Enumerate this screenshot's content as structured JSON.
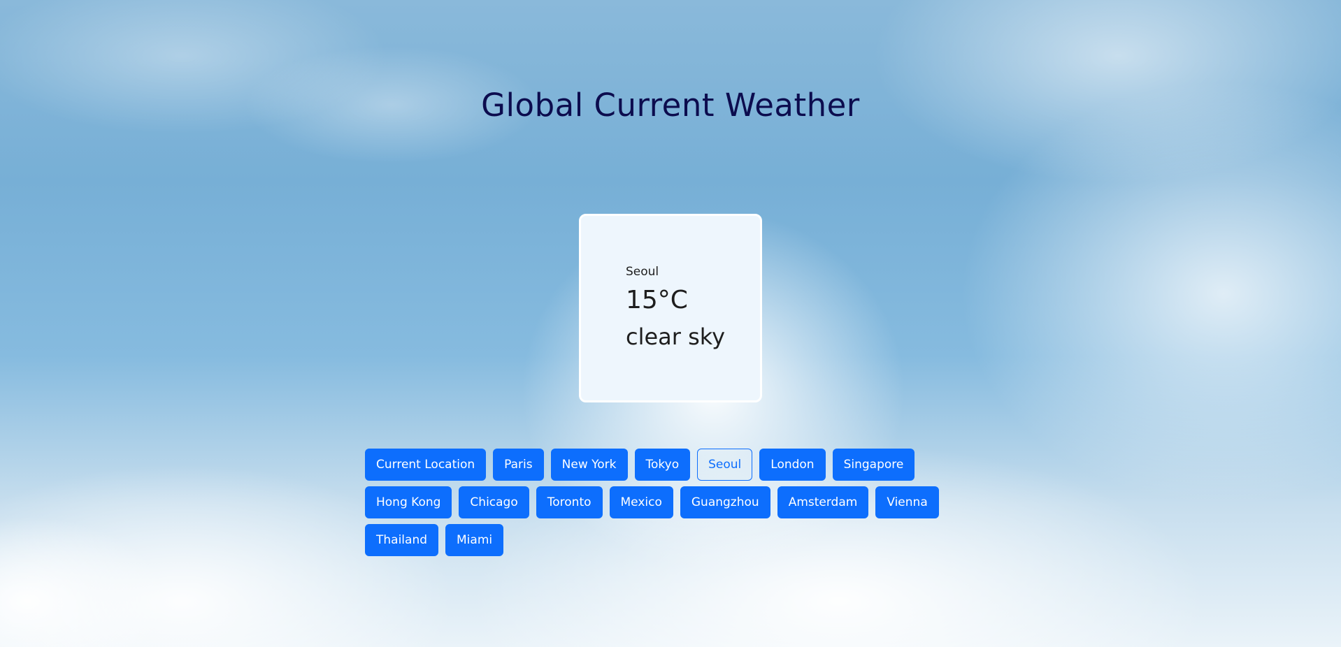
{
  "page": {
    "title": "Global Current Weather"
  },
  "weather": {
    "city": "Seoul",
    "temperature": "15°C",
    "description": "clear sky"
  },
  "city_buttons": [
    {
      "label": "Current Location",
      "active": false
    },
    {
      "label": "Paris",
      "active": false
    },
    {
      "label": "New York",
      "active": false
    },
    {
      "label": "Tokyo",
      "active": false
    },
    {
      "label": "Seoul",
      "active": true
    },
    {
      "label": "London",
      "active": false
    },
    {
      "label": "Singapore",
      "active": false
    },
    {
      "label": "Hong Kong",
      "active": false
    },
    {
      "label": "Chicago",
      "active": false
    },
    {
      "label": "Toronto",
      "active": false
    },
    {
      "label": "Mexico",
      "active": false
    },
    {
      "label": "Guangzhou",
      "active": false
    },
    {
      "label": "Amsterdam",
      "active": false
    },
    {
      "label": "Vienna",
      "active": false
    },
    {
      "label": "Thailand",
      "active": false
    },
    {
      "label": "Miami",
      "active": false
    }
  ],
  "colors": {
    "button_primary": "#0d6efd",
    "title": "#0c0c4e",
    "card_background": "#eef6fd"
  }
}
